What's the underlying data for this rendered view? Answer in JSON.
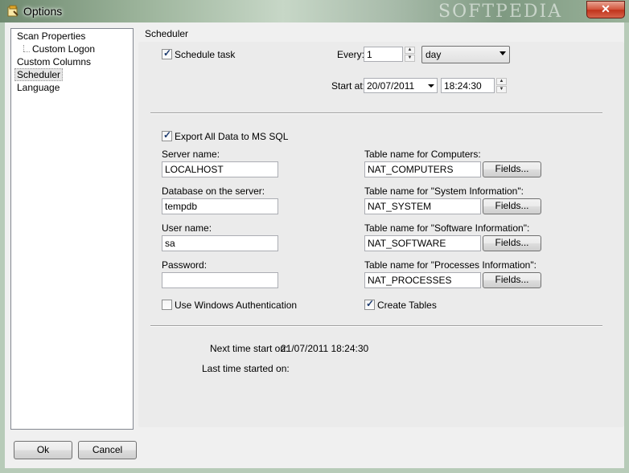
{
  "window": {
    "title": "Options",
    "close_glyph": "✕",
    "watermark": "SOFTPEDIA"
  },
  "tree": {
    "items": [
      {
        "label": "Scan Properties"
      },
      {
        "label": "Custom Logon"
      },
      {
        "label": "Custom Columns"
      },
      {
        "label": "Scheduler",
        "selected": true
      },
      {
        "label": "Language"
      }
    ]
  },
  "scheduler": {
    "group_title": "Scheduler",
    "schedule_task": {
      "label": "Schedule task",
      "checked": true
    },
    "every": {
      "label": "Every:",
      "value": "1",
      "unit": "day"
    },
    "start_at": {
      "label": "Start at:",
      "date": "20/07/2011",
      "time": "18:24:30"
    },
    "export": {
      "label": "Export All Data to MS SQL",
      "checked": true
    },
    "server_name": {
      "label": "Server name:",
      "value": "LOCALHOST"
    },
    "database": {
      "label": "Database on the server:",
      "value": "tempdb"
    },
    "user_name": {
      "label": "User name:",
      "value": "sa"
    },
    "password": {
      "label": "Password:",
      "value": ""
    },
    "windows_auth": {
      "label": "Use Windows Authentication",
      "checked": false
    },
    "tables": {
      "computers": {
        "label": "Table name for Computers:",
        "value": "NAT_COMPUTERS"
      },
      "system": {
        "label": "Table name for \"System Information\":",
        "value": "NAT_SYSTEM"
      },
      "software": {
        "label": "Table name for \"Software Information\":",
        "value": "NAT_SOFTWARE"
      },
      "processes": {
        "label": "Table name for \"Processes Information\":",
        "value": "NAT_PROCESSES"
      },
      "fields_label": "Fields..."
    },
    "create_tables": {
      "label": "Create Tables",
      "checked": true
    },
    "next_start": {
      "label": "Next time start on:",
      "value": "21/07/2011 18:24:30"
    },
    "last_started": {
      "label": "Last time started on:",
      "value": ""
    }
  },
  "buttons": {
    "ok": "Ok",
    "cancel": "Cancel"
  },
  "colors": {
    "titlebar_accent": "#9bb39a",
    "close_red": "#c0321a",
    "check_mark": "#1c3a6e"
  }
}
